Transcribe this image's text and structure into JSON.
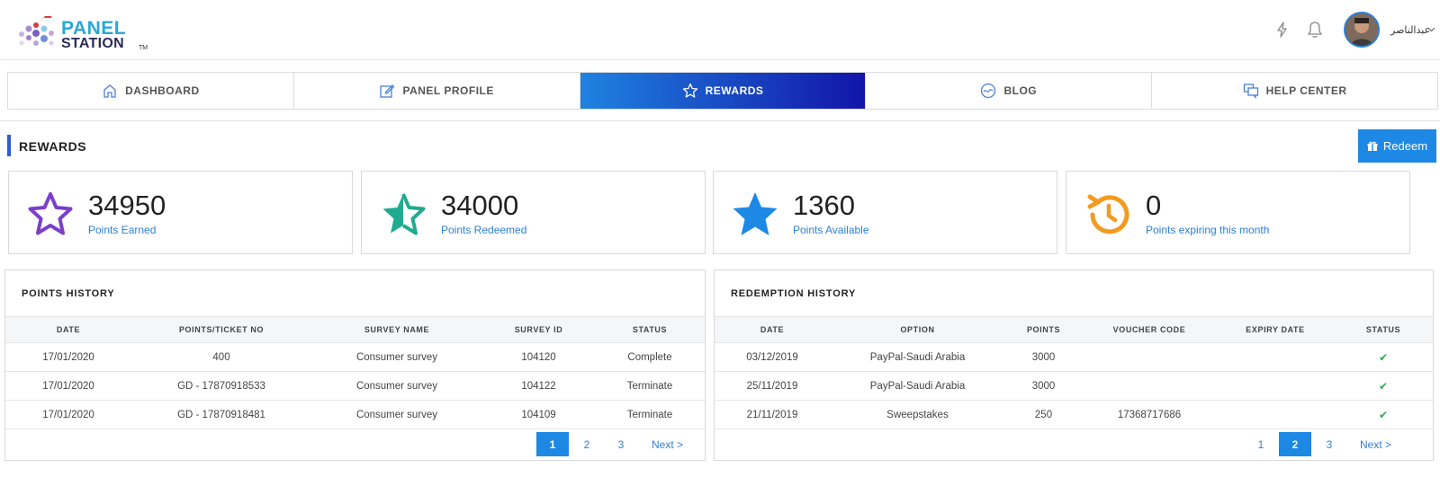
{
  "brand": {
    "name_line1": "PANEL",
    "name_line2": "STATION",
    "tm": "TM"
  },
  "header": {
    "user_name": "عبدالناصر"
  },
  "nav": {
    "tabs": [
      {
        "label": "DASHBOARD",
        "icon": "home-icon"
      },
      {
        "label": "PANEL PROFILE",
        "icon": "edit-icon"
      },
      {
        "label": "REWARDS",
        "icon": "star-icon",
        "active": true
      },
      {
        "label": "BLOG",
        "icon": "blog-icon"
      },
      {
        "label": "HELP CENTER",
        "icon": "chat-icon"
      }
    ]
  },
  "rewards": {
    "title": "REWARDS",
    "redeem_label": "Redeem",
    "stats": [
      {
        "value": "34950",
        "label": "Points Earned",
        "icon": "star-outline-icon",
        "color": "#7b3fc9"
      },
      {
        "value": "34000",
        "label": "Points Redeemed",
        "icon": "star-half-icon",
        "color": "#1fab8f"
      },
      {
        "value": "1360",
        "label": "Points Available",
        "icon": "star-filled-icon",
        "color": "#1e88e5"
      },
      {
        "value": "0",
        "label": "Points expiring this month",
        "icon": "history-icon",
        "color": "#f29b1e"
      }
    ]
  },
  "points_history": {
    "title": "POINTS HISTORY",
    "columns": [
      "DATE",
      "POINTS/TICKET NO",
      "SURVEY NAME",
      "SURVEY ID",
      "STATUS"
    ],
    "rows": [
      [
        "17/01/2020",
        "400",
        "Consumer survey",
        "104120",
        "Complete"
      ],
      [
        "17/01/2020",
        "GD - 17870918533",
        "Consumer survey",
        "104122",
        "Terminate"
      ],
      [
        "17/01/2020",
        "GD - 17870918481",
        "Consumer survey",
        "104109",
        "Terminate"
      ]
    ],
    "pages": [
      "1",
      "2",
      "3"
    ],
    "active_page": "1",
    "next_label": "Next >"
  },
  "redemption_history": {
    "title": "REDEMPTION HISTORY",
    "columns": [
      "DATE",
      "OPTION",
      "POINTS",
      "VOUCHER CODE",
      "EXPIRY DATE",
      "STATUS"
    ],
    "rows": [
      [
        "03/12/2019",
        "PayPal-Saudi Arabia",
        "3000",
        "",
        "",
        "✔"
      ],
      [
        "25/11/2019",
        "PayPal-Saudi Arabia",
        "3000",
        "",
        "",
        "✔"
      ],
      [
        "21/11/2019",
        "Sweepstakes",
        "250",
        "17368717686",
        "",
        "✔"
      ]
    ],
    "pages": [
      "1",
      "2",
      "3"
    ],
    "active_page": "2",
    "next_label": "Next >"
  }
}
